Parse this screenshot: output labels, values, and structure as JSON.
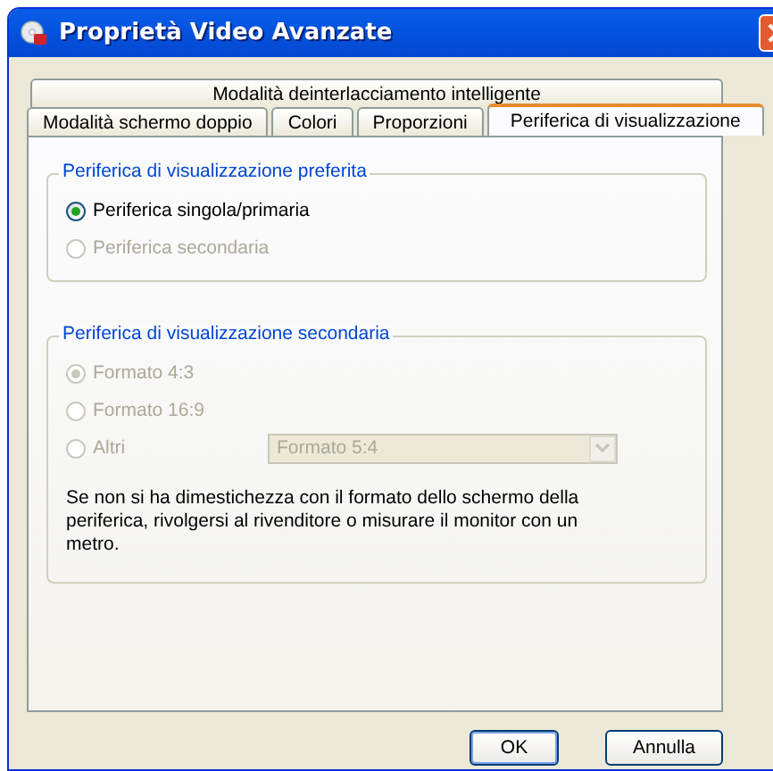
{
  "window": {
    "title": "Proprietà Video Avanzate"
  },
  "tab_rows": [
    [
      {
        "label": "Modalità deinterlacciamento intelligente",
        "selected": false
      }
    ],
    [
      {
        "label": "Modalità schermo doppio",
        "selected": false
      },
      {
        "label": "Colori",
        "selected": false
      },
      {
        "label": "Proporzioni",
        "selected": false
      },
      {
        "label": "Periferica di visualizzazione",
        "selected": true
      }
    ]
  ],
  "groups": [
    {
      "title": "Periferica di visualizzazione preferita",
      "options": [
        {
          "label": "Periferica singola/primaria",
          "selected": true,
          "disabled": false
        },
        {
          "label": "Periferica secondaria",
          "selected": false,
          "disabled": true
        }
      ]
    },
    {
      "title": "Periferica di visualizzazione secondaria",
      "options": [
        {
          "label": "Formato 4:3",
          "selected": true,
          "disabled": true
        },
        {
          "label": "Formato 16:9",
          "selected": false,
          "disabled": true
        },
        {
          "label": "Altri",
          "selected": false,
          "disabled": true,
          "dropdown": {
            "value": "Formato 5:4",
            "disabled": true
          }
        }
      ],
      "note": "Se non si ha dimestichezza con il formato dello schermo della periferica, rivolgersi al rivenditore o misurare il monitor con un metro."
    }
  ],
  "buttons": [
    {
      "label": "OK",
      "default": true
    },
    {
      "label": "Annulla",
      "default": false
    }
  ]
}
